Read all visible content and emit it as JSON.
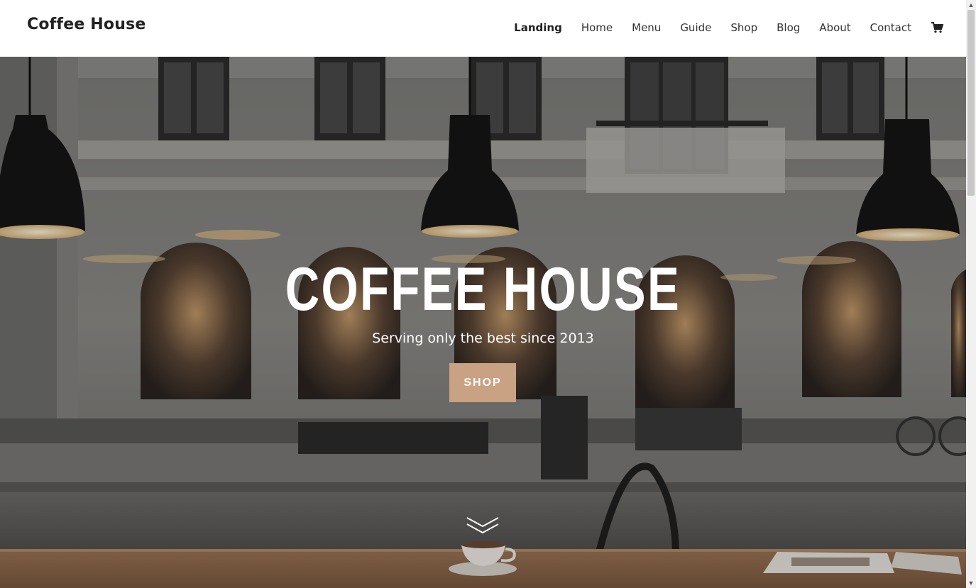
{
  "header": {
    "brand": "Coffee House",
    "nav": [
      "Landing",
      "Home",
      "Menu",
      "Guide",
      "Shop",
      "Blog",
      "About",
      "Contact"
    ],
    "active_nav": "Landing",
    "cart_icon": "shopping-cart-icon"
  },
  "hero": {
    "title": "COFFEE HOUSE",
    "subtitle": "Serving only the best since 2013",
    "button_label": "SHOP",
    "button_color": "#c9a183",
    "scroll_icon": "double-chevron-down-icon"
  },
  "colors": {
    "header_bg": "#ffffff",
    "text": "#222222",
    "hero_text": "#ffffff"
  }
}
